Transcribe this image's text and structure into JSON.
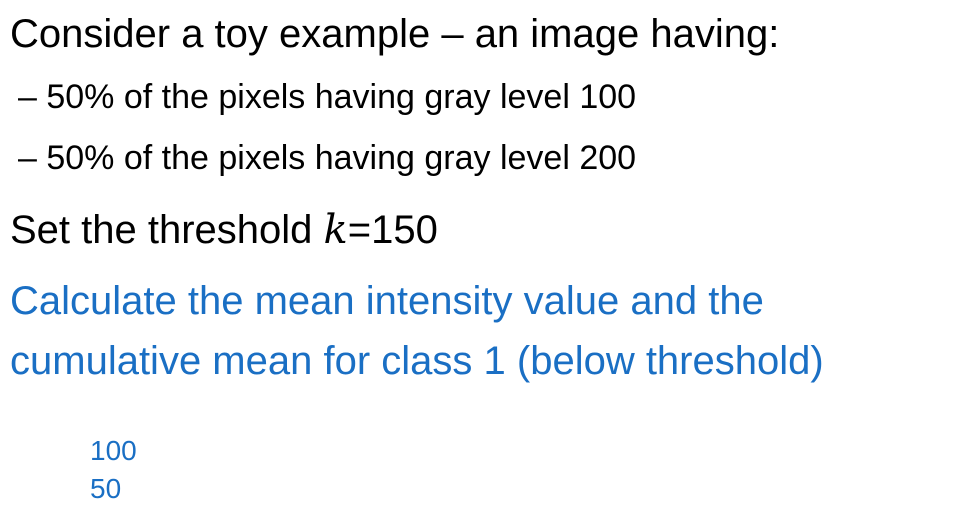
{
  "slide": {
    "heading": "Consider a toy example – an image having:",
    "bullets": [
      "– 50% of the pixels having gray level 100",
      "– 50% of the pixels having gray level 200"
    ],
    "threshold": {
      "prefix": "Set the threshold ",
      "variable": "k",
      "suffix": "=150"
    },
    "question": [
      "Calculate the mean intensity value and the",
      "cumulative mean for class 1 (below threshold)"
    ],
    "answers": [
      "100",
      "50"
    ],
    "colors": {
      "text": "#000000",
      "accent": "#1a6fc4"
    }
  }
}
